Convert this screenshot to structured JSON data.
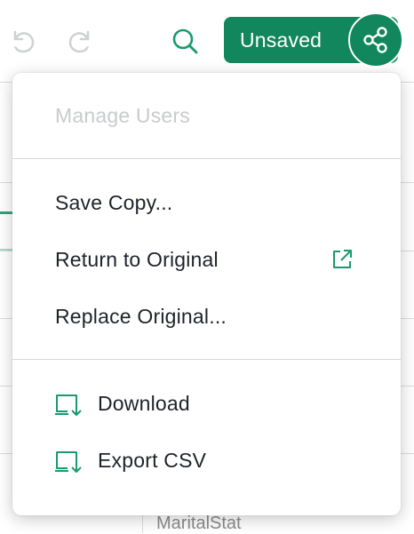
{
  "toolbar": {
    "undo_icon": "undo-icon",
    "redo_icon": "redo-icon",
    "search_icon": "search-icon",
    "unsaved_label": "Unsaved",
    "share_icon": "share-icon"
  },
  "menu": {
    "manage_users": "Manage Users",
    "save_copy": "Save Copy...",
    "return_original": "Return to Original",
    "replace_original": "Replace Original...",
    "download": "Download",
    "export_csv": "Export CSV"
  },
  "background": {
    "peek_text": "MaritalStat"
  },
  "colors": {
    "brand_green": "#12875e",
    "icon_green": "#1a9a6c",
    "disabled_text": "#c9cbce",
    "text": "#1f2329"
  }
}
